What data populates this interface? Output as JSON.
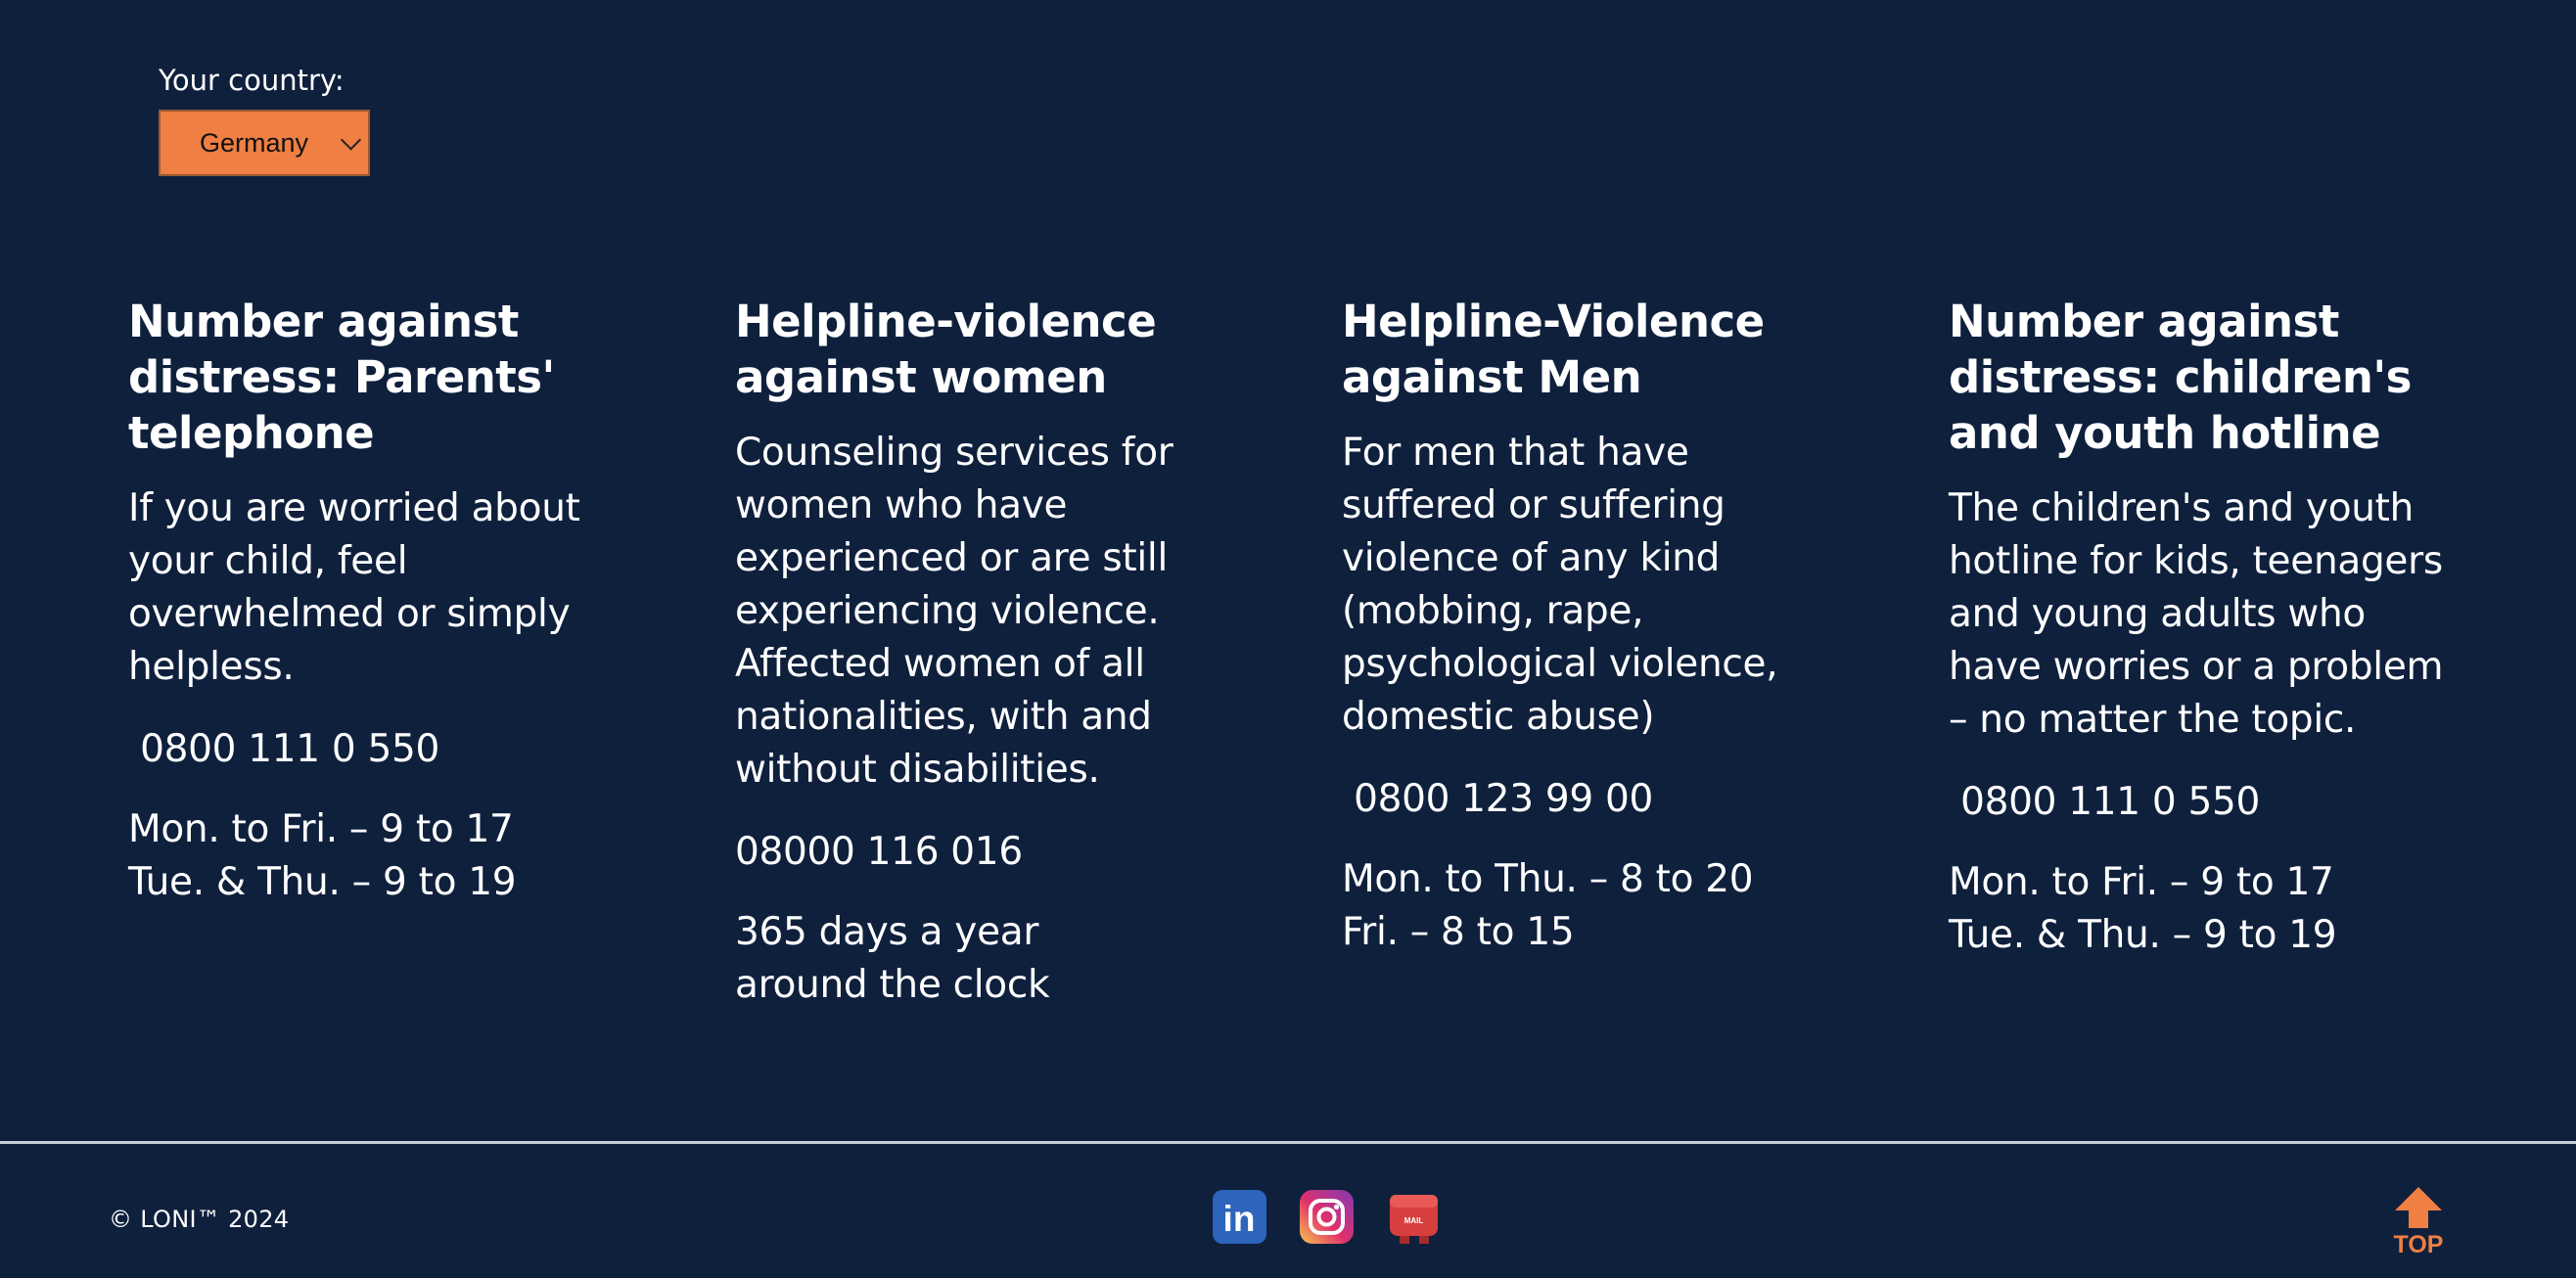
{
  "country": {
    "label": "Your country:",
    "selected": "Germany"
  },
  "helplines": [
    {
      "title_lines": [
        "Number against",
        "distress: Parents'",
        "telephone"
      ],
      "desc_lines": [
        "If you are worried about",
        "your child, feel",
        "overwhelmed or simply",
        "helpless."
      ],
      "phone": " 0800 111 0 550",
      "hours_lines": [
        "Mon. to Fri. – 9 to 17",
        "Tue. & Thu. – 9 to 19"
      ]
    },
    {
      "title_lines": [
        "Helpline-violence",
        "against women"
      ],
      "desc_lines": [
        "Counseling services for",
        "women who have",
        "experienced or are still",
        "experiencing violence.",
        "Affected women of all",
        "nationalities, with and",
        "without disabilities."
      ],
      "phone": "08000 116 016",
      "hours_lines": [
        "365 days a year",
        "around the clock"
      ]
    },
    {
      "title_lines": [
        "Helpline-Violence",
        "against Men"
      ],
      "desc_lines": [
        "For men that have",
        "suffered or suffering",
        "violence of any kind",
        "(mobbing, rape,",
        "psychological violence,",
        "domestic abuse)"
      ],
      "phone": " 0800 123 99 00",
      "hours_lines": [
        "Mon. to Thu. – 8 to 20",
        "Fri. – 8 to 15"
      ]
    },
    {
      "title_lines": [
        "Number against",
        "distress: children's",
        "and youth hotline"
      ],
      "desc_lines": [
        "The children's and youth",
        "hotline for kids, teenagers",
        "and young adults who",
        "have worries or a problem",
        "– no matter the topic."
      ],
      "phone": " 0800 111 0 550",
      "hours_lines": [
        "Mon. to Fri. – 9 to 17",
        "Tue. & Thu. – 9 to 19"
      ]
    }
  ],
  "footer": {
    "copyright": "© LONI™ 2024",
    "social": [
      {
        "icon": "linkedin-icon",
        "text": "in"
      },
      {
        "icon": "instagram-icon"
      },
      {
        "icon": "mail-icon",
        "text": "MAIL"
      }
    ],
    "top_label": "TOP"
  },
  "colors": {
    "background": "#0f203d",
    "accent": "#ef7f43",
    "text": "#ffffff"
  }
}
